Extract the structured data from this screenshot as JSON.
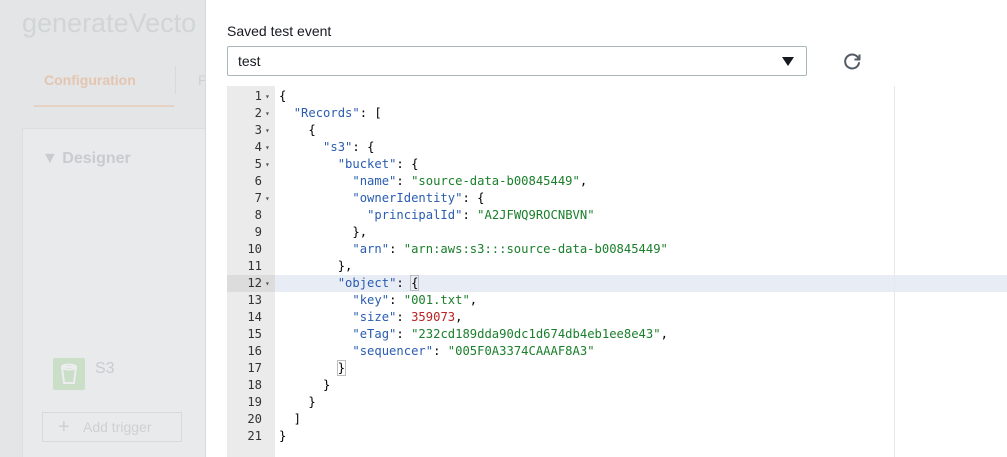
{
  "background": {
    "function_title": "generateVecto",
    "tabs": [
      "Configuration",
      "Perm"
    ],
    "designer_label": "Designer",
    "trigger_label": "S3",
    "add_trigger_label": "Add trigger"
  },
  "dialog": {
    "field_label": "Saved test event",
    "selected_event": "test",
    "refresh_icon": "refresh-icon"
  },
  "editor": {
    "active_line": 12,
    "lines": [
      {
        "n": "1",
        "fold": true,
        "code": "{"
      },
      {
        "n": "2",
        "fold": true,
        "code": "  \"Records\": ["
      },
      {
        "n": "3",
        "fold": true,
        "code": "    {"
      },
      {
        "n": "4",
        "fold": true,
        "code": "      \"s3\": {"
      },
      {
        "n": "5",
        "fold": true,
        "code": "        \"bucket\": {"
      },
      {
        "n": "6",
        "fold": false,
        "code": "          \"name\": \"source-data-b00845449\","
      },
      {
        "n": "7",
        "fold": true,
        "code": "          \"ownerIdentity\": {"
      },
      {
        "n": "8",
        "fold": false,
        "code": "            \"principalId\": \"A2JFWQ9ROCNBVN\""
      },
      {
        "n": "9",
        "fold": false,
        "code": "          },"
      },
      {
        "n": "10",
        "fold": false,
        "code": "          \"arn\": \"arn:aws:s3:::source-data-b00845449\""
      },
      {
        "n": "11",
        "fold": false,
        "code": "        },"
      },
      {
        "n": "12",
        "fold": true,
        "code": "        \"object\": {"
      },
      {
        "n": "13",
        "fold": false,
        "code": "          \"key\": \"001.txt\","
      },
      {
        "n": "14",
        "fold": false,
        "code": "          \"size\": 359073,"
      },
      {
        "n": "15",
        "fold": false,
        "code": "          \"eTag\": \"232cd189dda90dc1d674db4eb1ee8e43\","
      },
      {
        "n": "16",
        "fold": false,
        "code": "          \"sequencer\": \"005F0A3374CAAAF8A3\""
      },
      {
        "n": "17",
        "fold": false,
        "code": "        }"
      },
      {
        "n": "18",
        "fold": false,
        "code": "      }"
      },
      {
        "n": "19",
        "fold": false,
        "code": "    }"
      },
      {
        "n": "20",
        "fold": false,
        "code": "  ]"
      },
      {
        "n": "21",
        "fold": false,
        "code": "}"
      }
    ]
  }
}
